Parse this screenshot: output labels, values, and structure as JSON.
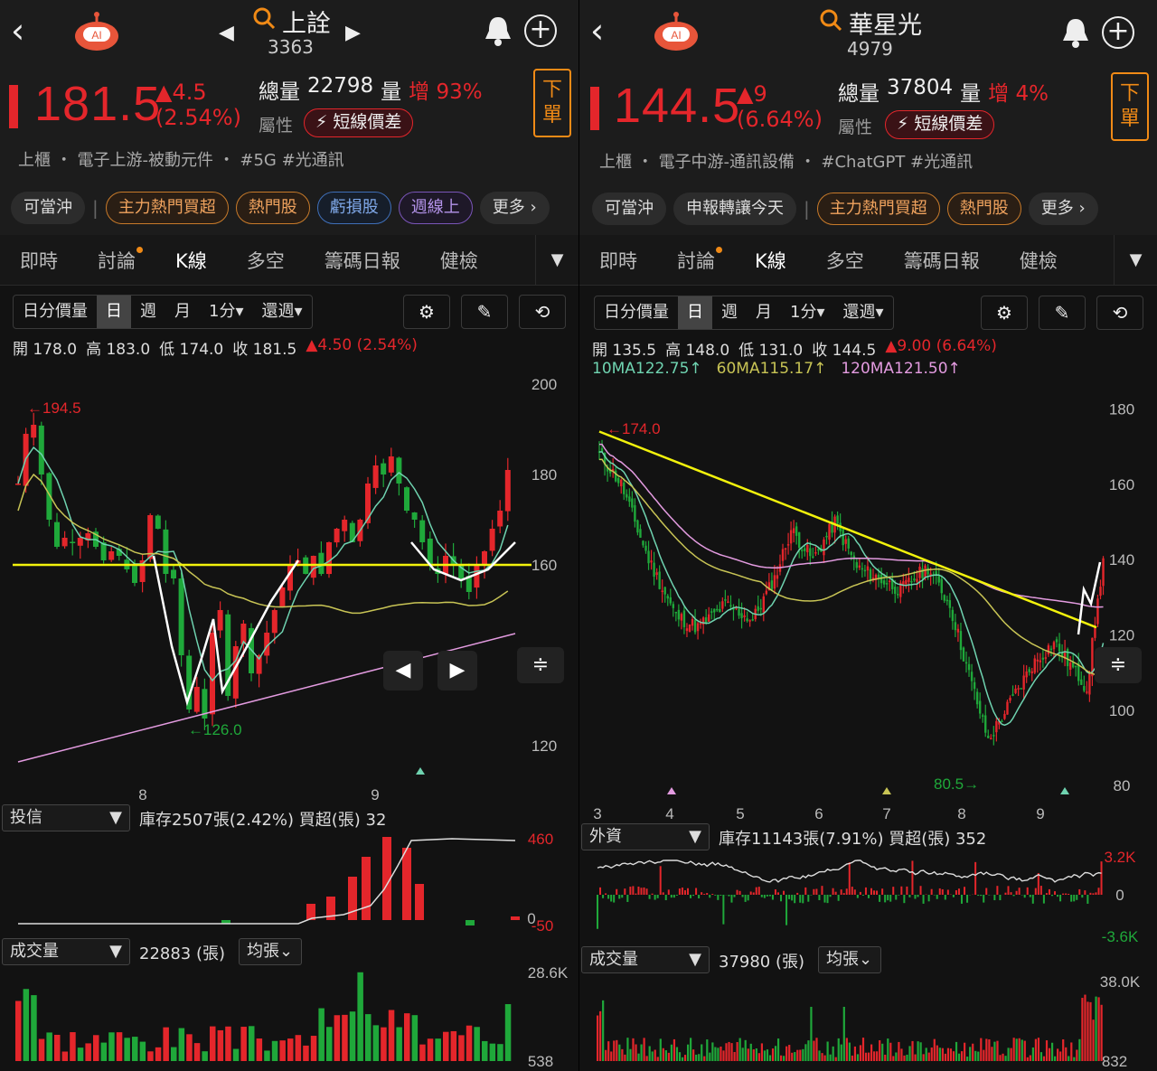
{
  "left": {
    "title": "上詮",
    "code": "3363",
    "price": "181.5",
    "change": "▲4.5",
    "change_pct": "(2.54%)",
    "volume_label": "總量",
    "volume": "22798",
    "vol_word": "量",
    "vol_inc": "增 93%",
    "attr_label": "屬性",
    "badge": "短線價差",
    "order": "下\n單",
    "industry": "上櫃 ・ 電子上游-被動元件 ・ #5G  #光通訊",
    "chips": [
      "可當沖",
      "主力熱門買超",
      "熱門股",
      "虧損股",
      "週線上",
      "更多 ›"
    ],
    "tabs": [
      "即時",
      "討論",
      "K線",
      "多空",
      "籌碼日報",
      "健檢"
    ],
    "toolbar": [
      "日分價量",
      "日",
      "週",
      "月",
      "1分▾",
      "還週▾"
    ],
    "ohlc": {
      "o": "開 178.0",
      "h": "高 183.0",
      "l": "低 174.0",
      "c": "收 181.5",
      "chg": "▲4.50 (2.54%)"
    },
    "high_label": "←194.5",
    "low_label": "←126.0",
    "xlabels": [
      "8",
      "9"
    ],
    "inv_sel": "投信",
    "inv_info": "庫存2507張(2.42%)  買超(張) 32",
    "vol_sel": "成交量",
    "vol_info": "22883 (張)",
    "avg": "均張⌄"
  },
  "right": {
    "title": "華星光",
    "code": "4979",
    "price": "144.5",
    "change": "▲9",
    "change_pct": "(6.64%)",
    "volume_label": "總量",
    "volume": "37804",
    "vol_word": "量",
    "vol_inc": "增 4%",
    "attr_label": "屬性",
    "badge": "短線價差",
    "order": "下\n單",
    "industry": "上櫃 ・ 電子中游-通訊設備 ・ #ChatGPT  #光通訊",
    "chips": [
      "可當沖",
      "申報轉讓今天",
      "主力熱門買超",
      "熱門股",
      "更多 ›"
    ],
    "tabs": [
      "即時",
      "討論",
      "K線",
      "多空",
      "籌碼日報",
      "健檢"
    ],
    "toolbar": [
      "日分價量",
      "日",
      "週",
      "月",
      "1分▾",
      "還週▾"
    ],
    "ohlc": {
      "o": "開 135.5",
      "h": "高 148.0",
      "l": "低 131.0",
      "c": "收 144.5",
      "chg": "▲9.00 (6.64%)"
    },
    "ma": {
      "ma10": "10MA122.75↑",
      "ma60": "60MA115.17↑",
      "ma120": "120MA121.50↑"
    },
    "high_label": "←174.0",
    "low_label": "80.5→",
    "xlabels": [
      "3",
      "4",
      "5",
      "6",
      "7",
      "8",
      "9"
    ],
    "inv_sel": "外資",
    "inv_info": "庫存11143張(7.91%)  買超(張) 352",
    "vol_sel": "成交量",
    "vol_info": "37980 (張)",
    "avg": "均張⌄"
  },
  "chart_data": [
    {
      "type": "candlestick",
      "name": "上詮",
      "yticks": [
        200,
        180,
        160,
        120
      ],
      "yrange": [
        112,
        202
      ],
      "inst_axis": [
        "460",
        "0",
        "-50"
      ],
      "vol_axis": [
        "28.6K",
        "538"
      ],
      "ma_lines": [
        "short",
        "long(yellow)",
        "long(pink)"
      ],
      "trendline": 160
    },
    {
      "type": "candlestick",
      "name": "華星光",
      "yticks": [
        180,
        160,
        140,
        120,
        100,
        80
      ],
      "yrange": [
        75,
        183
      ],
      "inst_axis": [
        "3.2K",
        "0",
        "-3.6K"
      ],
      "vol_axis": [
        "38.0K",
        "832"
      ],
      "trendline_from": 174,
      "trendline_to": 122
    }
  ],
  "colors": {
    "up": "#e4262b",
    "down": "#1fa83a",
    "ma_short": "#6fd3b0",
    "ma_mid": "#c8c455",
    "ma_long": "#e39be0",
    "trend": "#f2f20c",
    "accent": "#f08a16"
  }
}
